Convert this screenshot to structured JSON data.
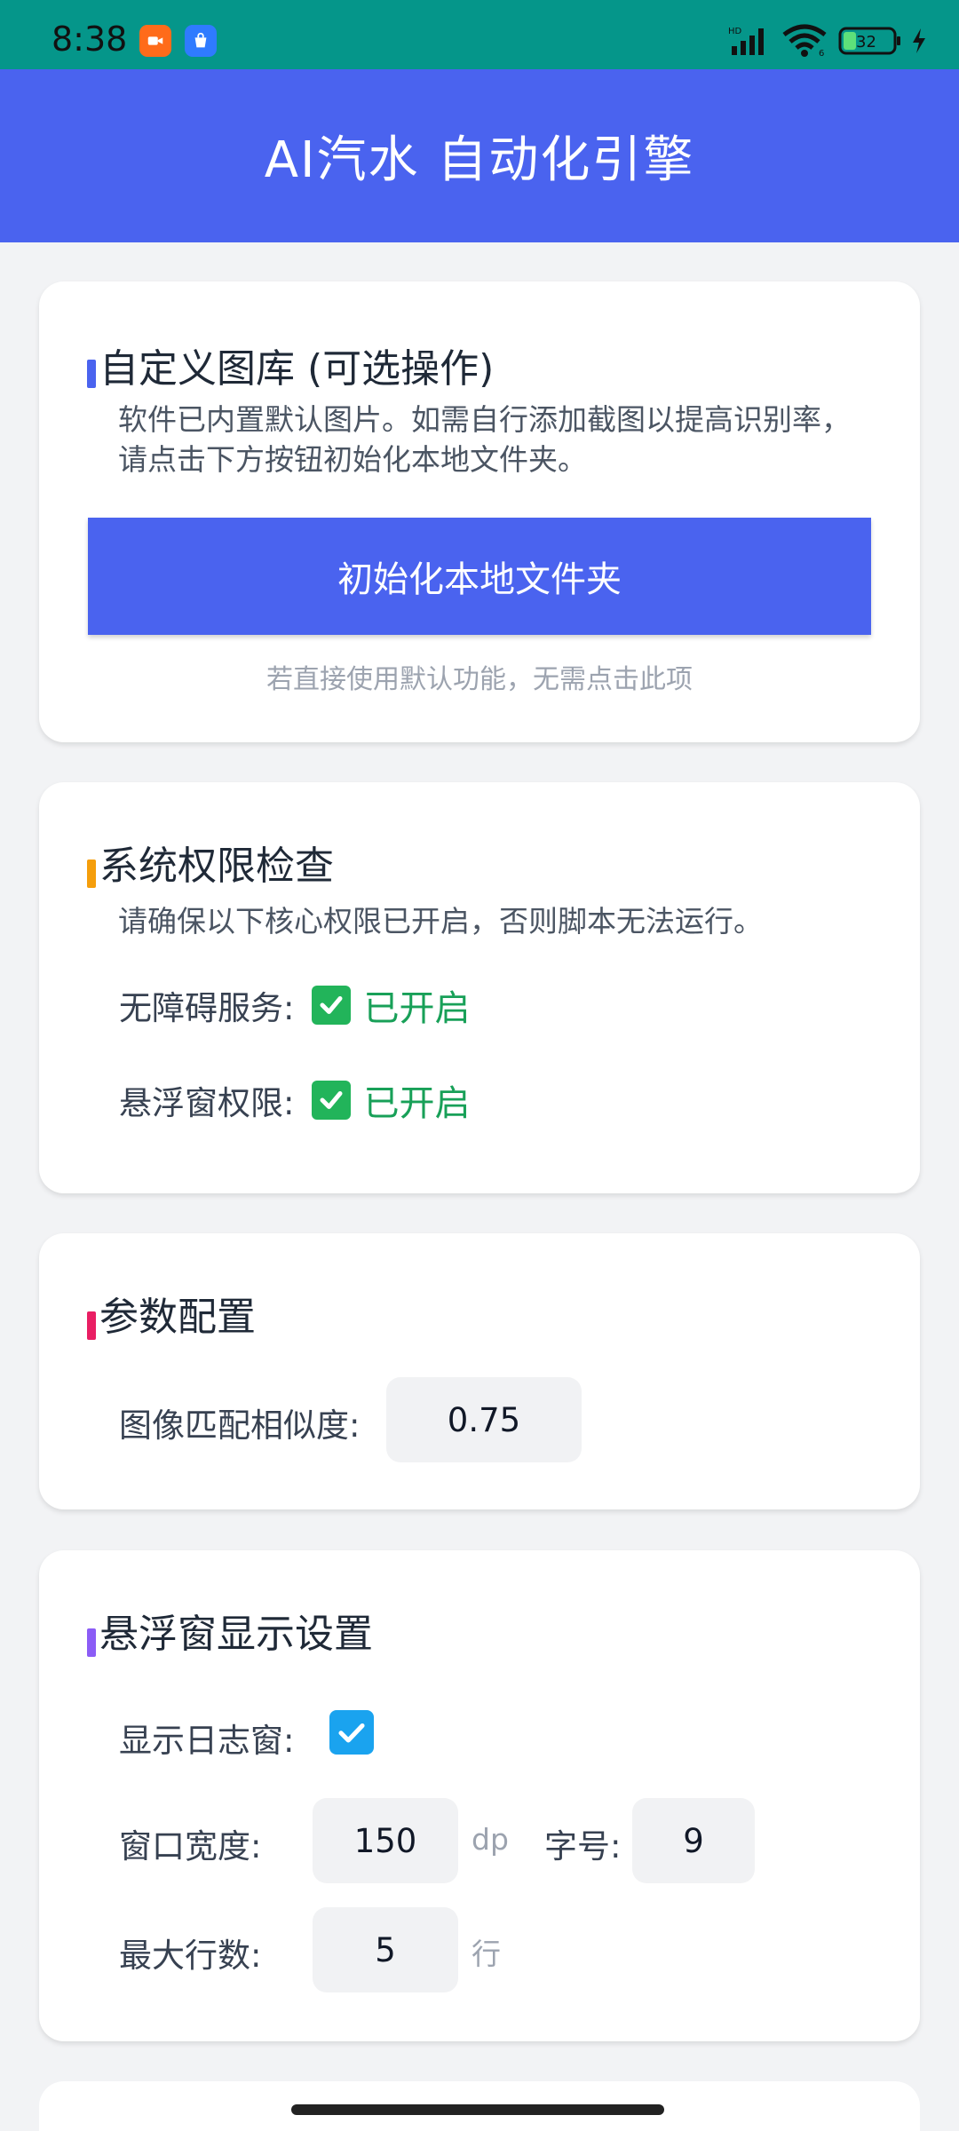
{
  "status_bar": {
    "time": "8:38",
    "icons": [
      "screen-record-icon",
      "app-store-icon",
      "hd-signal-icon",
      "wifi-icon",
      "battery-icon",
      "charging-icon"
    ],
    "battery": "32"
  },
  "header": {
    "title": "AI汽水 自动化引擎"
  },
  "gallery_card": {
    "title": "自定义图库 (可选操作)",
    "desc_line1": "软件已内置默认图片。如需自行添加截图以提高识别率，",
    "desc_line2": "请点击下方按钮初始化本地文件夹。",
    "button_label": "初始化本地文件夹",
    "hint": "若直接使用默认功能，无需点击此项",
    "accent_color": "#4a63ef"
  },
  "permission_card": {
    "title": "系统权限检查",
    "desc": "请确保以下核心权限已开启，否则脚本无法运行。",
    "accent_color": "#f59e0b",
    "items": [
      {
        "label": "无障碍服务:",
        "status": "已开启"
      },
      {
        "label": "悬浮窗权限:",
        "status": "已开启"
      }
    ]
  },
  "params_card": {
    "title": "参数配置",
    "accent_color": "#e91e63",
    "similarity_label": "图像匹配相似度:",
    "similarity_value": "0.75"
  },
  "float_card": {
    "title": "悬浮窗显示设置",
    "accent_color": "#8b5cf6",
    "show_log_label": "显示日志窗:",
    "show_log_checked": true,
    "width_label": "窗口宽度:",
    "width_value": "150",
    "width_unit": "dp",
    "font_label": "字号:",
    "font_value": "9",
    "max_lines_label": "最大行数:",
    "max_lines_value": "5",
    "max_lines_unit": "行"
  }
}
